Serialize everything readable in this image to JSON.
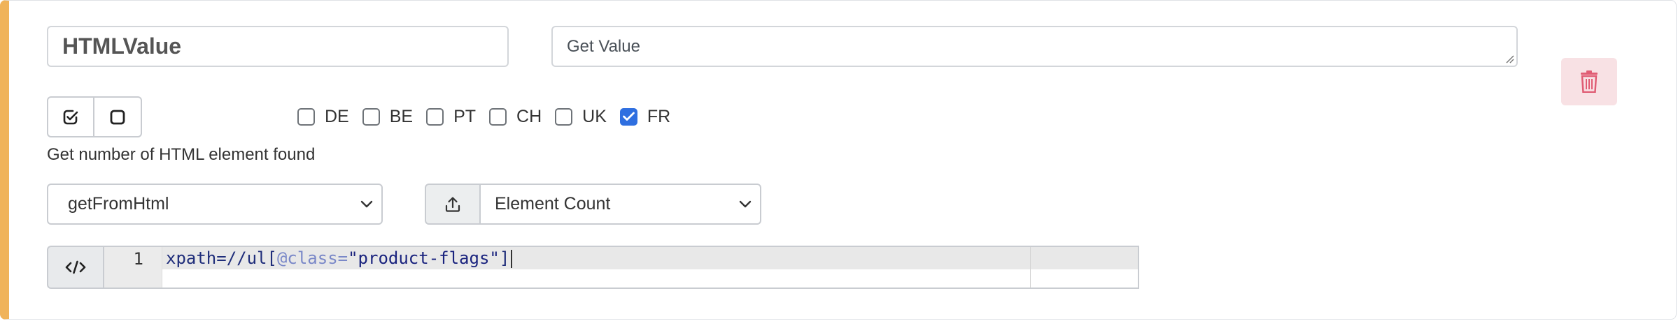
{
  "form": {
    "name_value": "HTMLValue",
    "description_placeholder": "Get Value",
    "help_text": "Get number of HTML element found"
  },
  "countries": [
    {
      "label": "DE",
      "checked": false
    },
    {
      "label": "BE",
      "checked": false
    },
    {
      "label": "PT",
      "checked": false
    },
    {
      "label": "CH",
      "checked": false
    },
    {
      "label": "UK",
      "checked": false
    },
    {
      "label": "FR",
      "checked": true
    }
  ],
  "method_select": {
    "value": "getFromHtml"
  },
  "output_select": {
    "value": "Element Count"
  },
  "editor": {
    "line_number": "1",
    "code_prefix": "xpath=//ul[",
    "code_attr": "@class=",
    "code_string": "\"product-flags\"",
    "code_suffix": "]"
  },
  "colors": {
    "accent_border": "#f0b35a",
    "checkbox_checked": "#2f6fe0",
    "delete_bg": "#f8e1e4",
    "delete_icon": "#e05d74"
  },
  "icons": {
    "delete": "trash-icon",
    "check_all": "checkbox-checked-icon",
    "uncheck_all": "checkbox-empty-icon",
    "upload": "upload-icon",
    "code": "code-icon",
    "chevron": "chevron-down-icon"
  }
}
